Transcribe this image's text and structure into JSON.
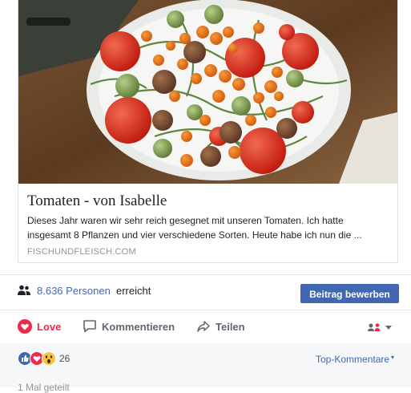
{
  "link_preview": {
    "title": "Tomaten - von Isabelle",
    "description": "Dieses Jahr waren wir sehr reich gesegnet mit unseren Tomaten. Ich hatte insgesamt 8 Pflanzen und vier verschiedene Sorten. Heute habe ich nun die ...",
    "domain": "FISCHUNDFLEISCH.COM"
  },
  "reach": {
    "count": "8.636 Personen",
    "label": "erreicht",
    "boost_button": "Beitrag bewerben"
  },
  "actions": {
    "love": "Love",
    "comment": "Kommentieren",
    "share": "Teilen"
  },
  "reactions": {
    "count": "26",
    "sort_label": "Top-Kommentare",
    "shared": "1 Mal geteilt"
  },
  "colors": {
    "facebook_blue": "#4267b2",
    "love_red": "#f0284a"
  }
}
